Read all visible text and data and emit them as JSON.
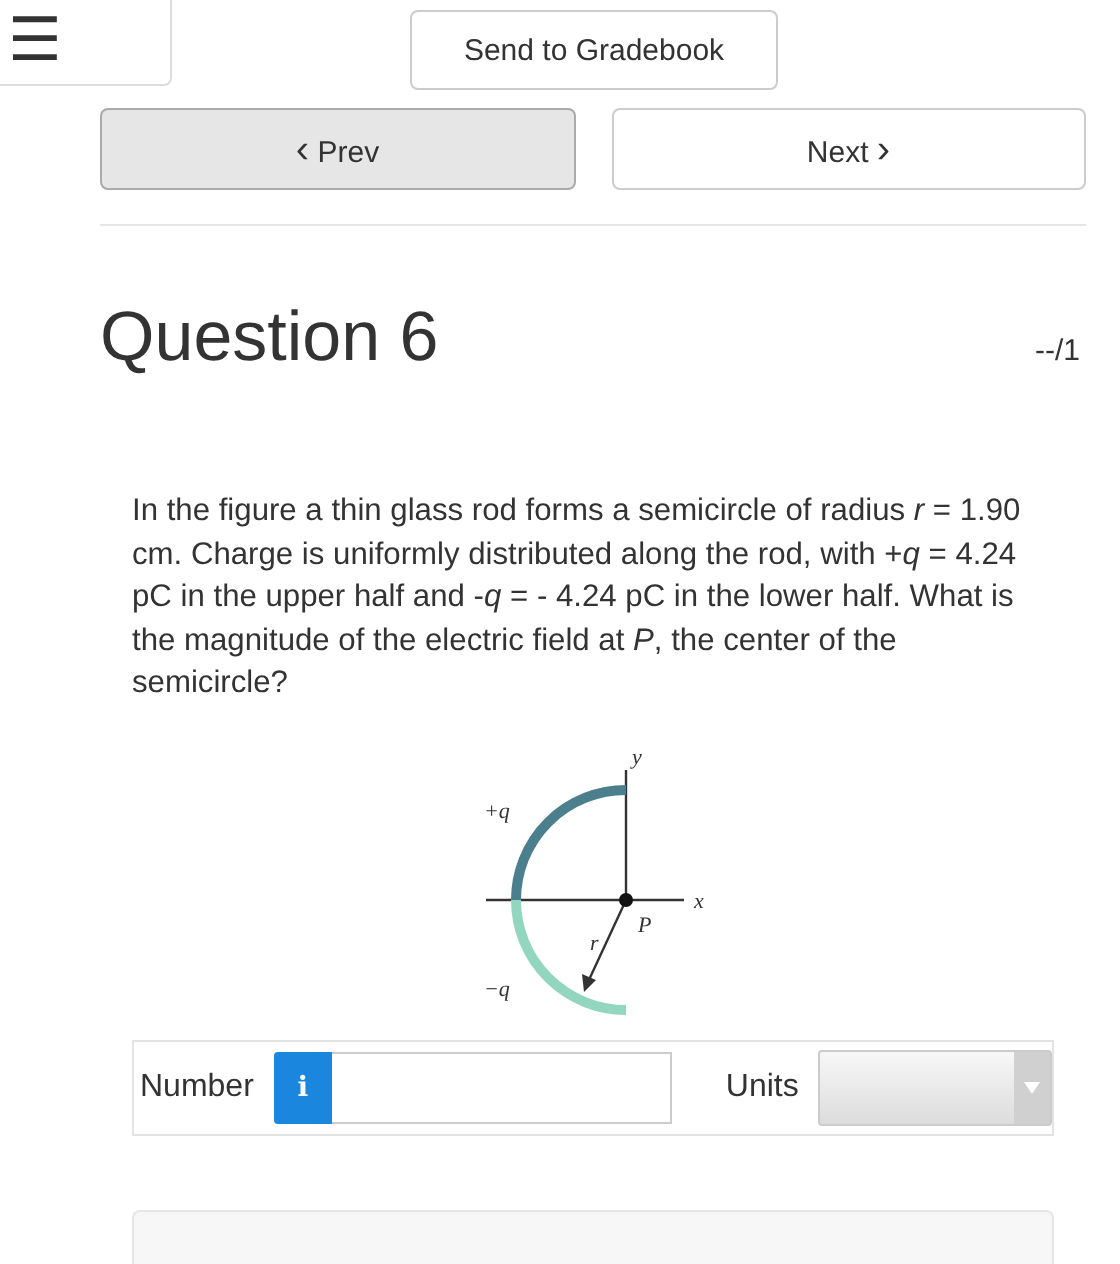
{
  "toolbar": {
    "menu_button": "☰",
    "send_button": "Send to Gradebook"
  },
  "nav": {
    "prev": {
      "arrow": "‹",
      "label": "Prev"
    },
    "next": {
      "label": "Next",
      "arrow": "›"
    }
  },
  "question": {
    "title": "Question 6",
    "score": "--/1",
    "text": "In the figure a thin glass rod forms a semicircle of radius *r* = 1.90 cm. Charge is uniformly distributed along the rod, with +*q* = 4.24 pC in the upper half and -*q* = - 4.24 pC in the lower half. What is the magnitude of the electric field at *P*, the center of the semicircle?",
    "figure": {
      "labels": [
        {
          "kind": "charge",
          "text": "+q"
        },
        {
          "kind": "charge",
          "text": "−q"
        },
        {
          "kind": "axis",
          "text": "y"
        },
        {
          "kind": "axis",
          "text": "x"
        },
        {
          "kind": "point",
          "text": "P"
        },
        {
          "kind": "radius",
          "text": "r"
        }
      ]
    }
  },
  "answer": {
    "number_label": "Number",
    "info_button": "i",
    "units_label": "Units"
  }
}
